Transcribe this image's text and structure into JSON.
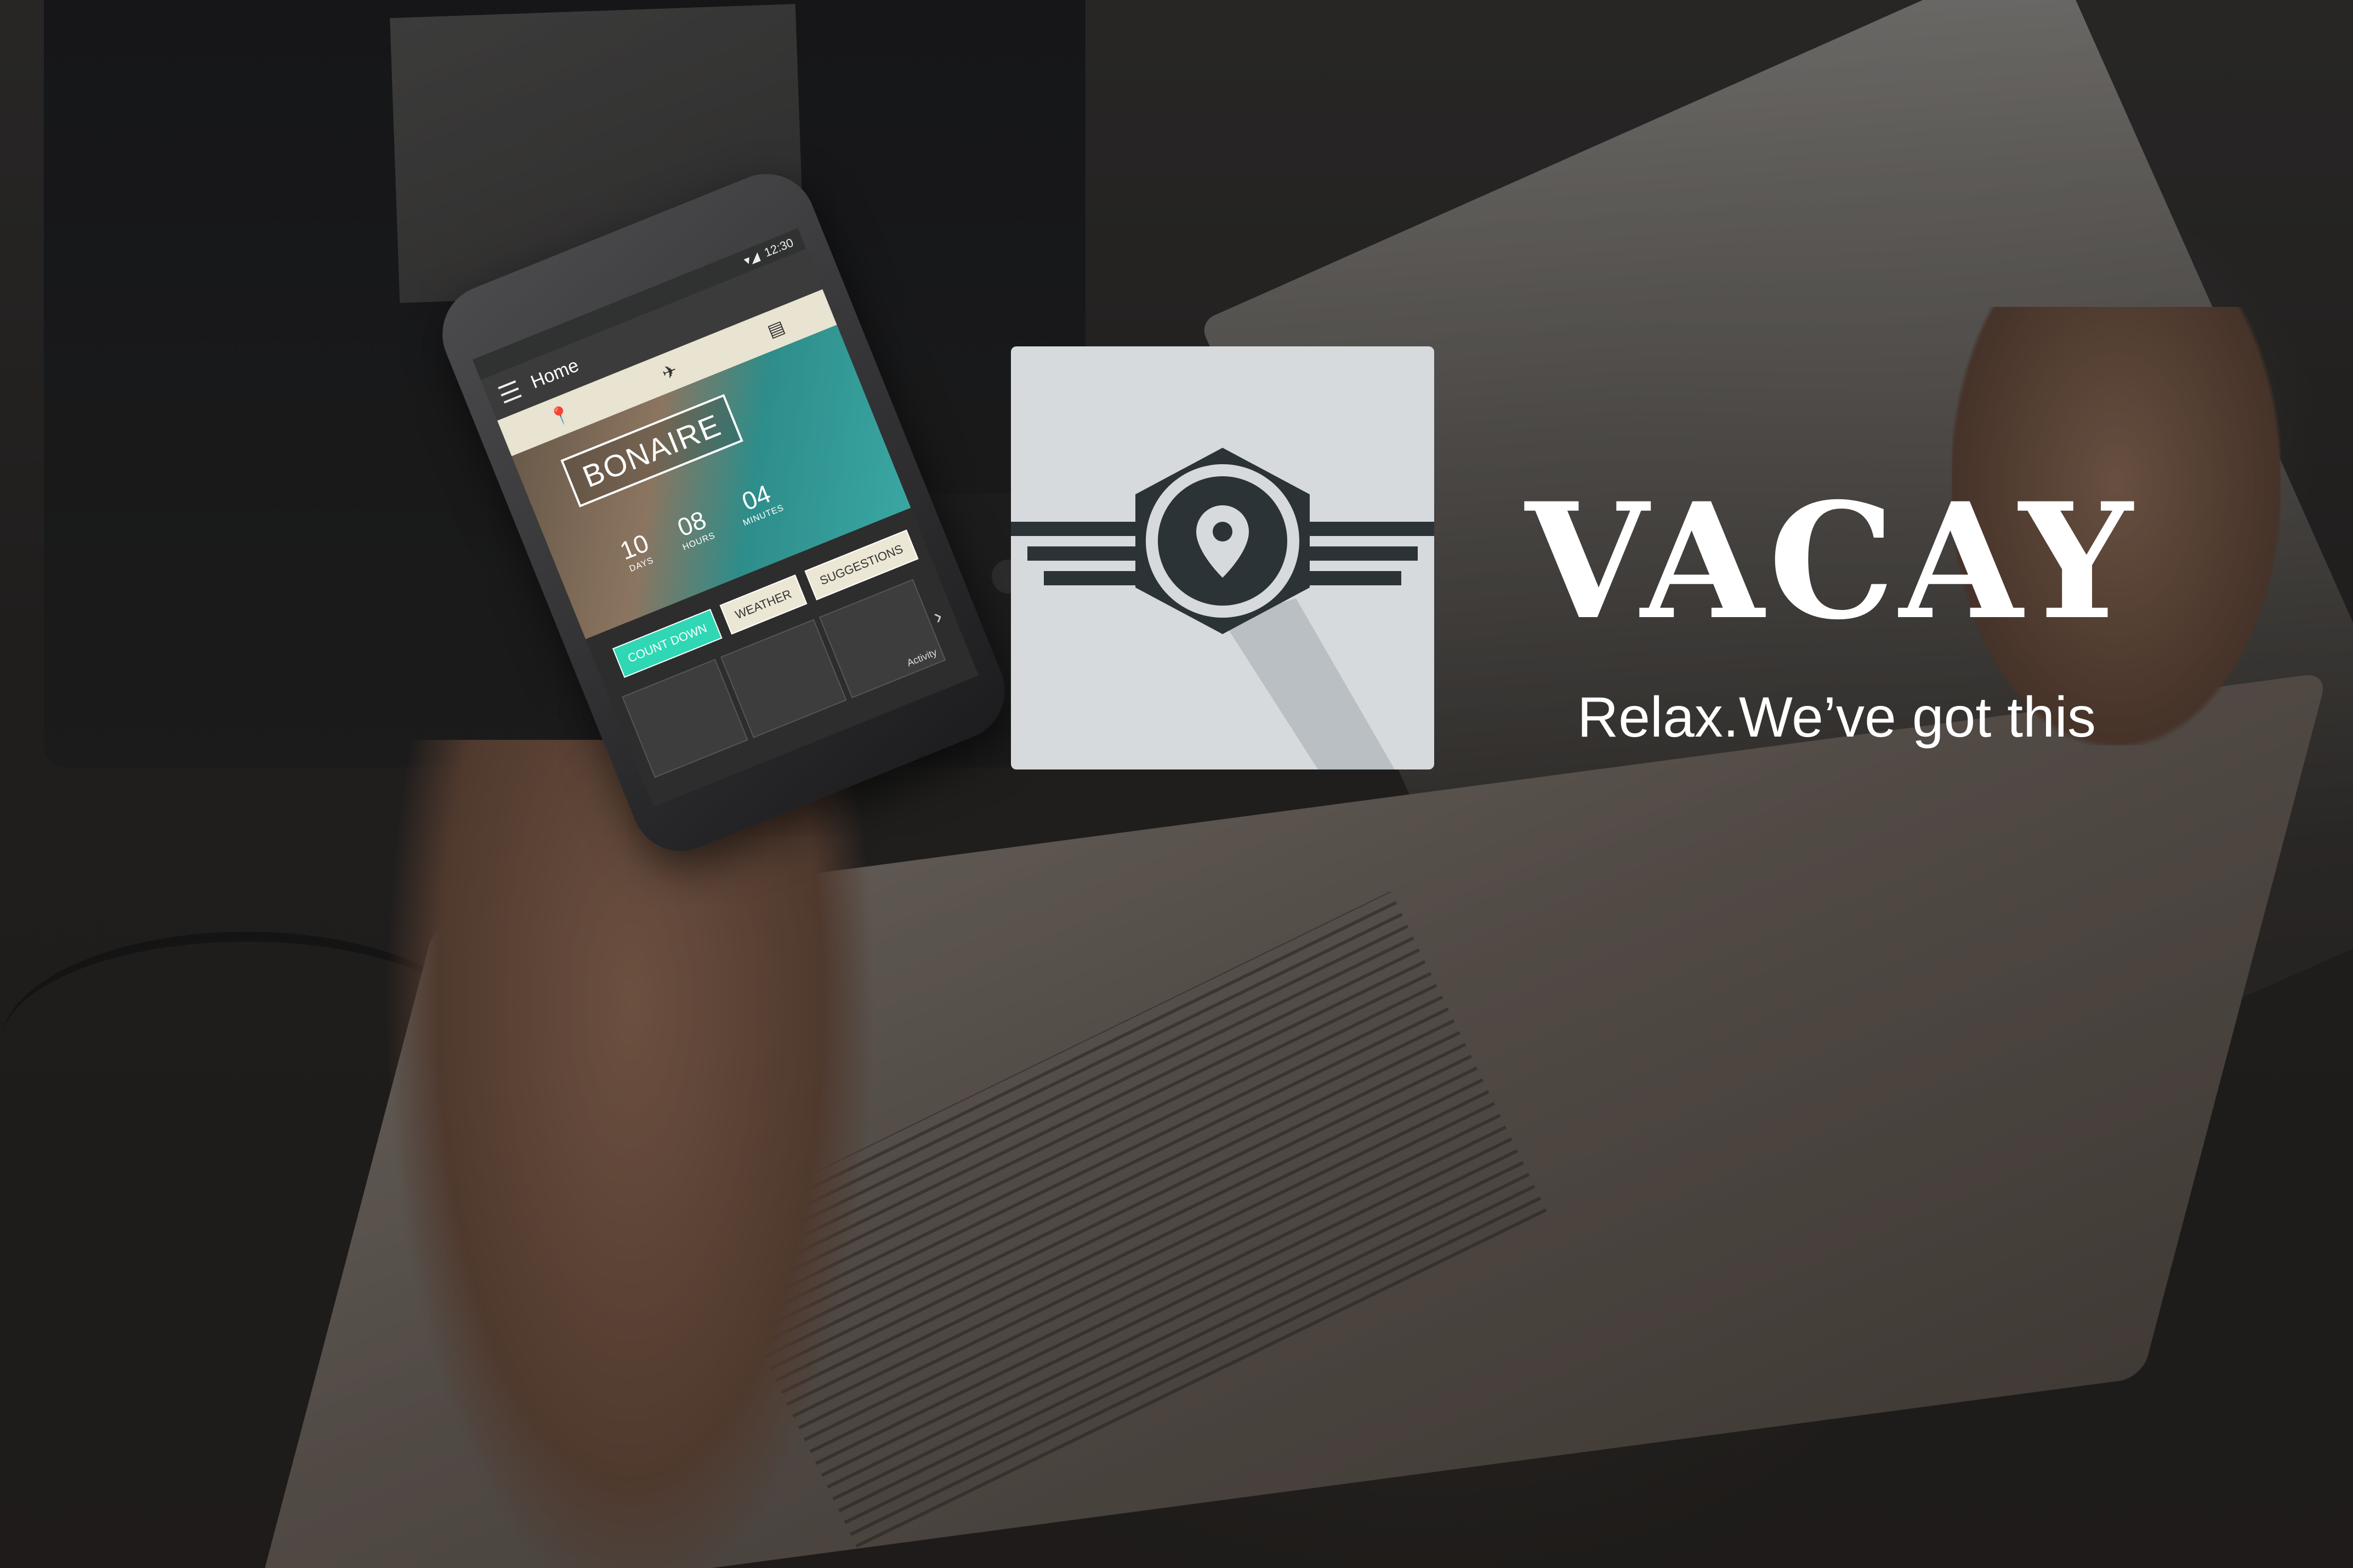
{
  "brand": {
    "name": "VACAY",
    "tagline": "Relax.We’ve got this",
    "logo_icon": "map-pin-wings-icon",
    "logo_bg": "#d6dadd",
    "logo_fg": "#2c3337"
  },
  "phone": {
    "status_time": "12:30",
    "app_bar_title": "Home",
    "tabs": [
      "pin-icon",
      "compass-icon",
      "notes-icon"
    ],
    "destination": "BONAIRE",
    "countdown": [
      {
        "value": "10",
        "label": "DAYS"
      },
      {
        "value": "08",
        "label": "HOURS"
      },
      {
        "value": "04",
        "label": "MINUTES"
      }
    ],
    "buttons": [
      "COUNT DOWN",
      "WEATHER",
      "SUGGESTIONS"
    ],
    "active_button": "COUNT DOWN",
    "accent": "#2fd7b4",
    "card_label": "Activity"
  }
}
